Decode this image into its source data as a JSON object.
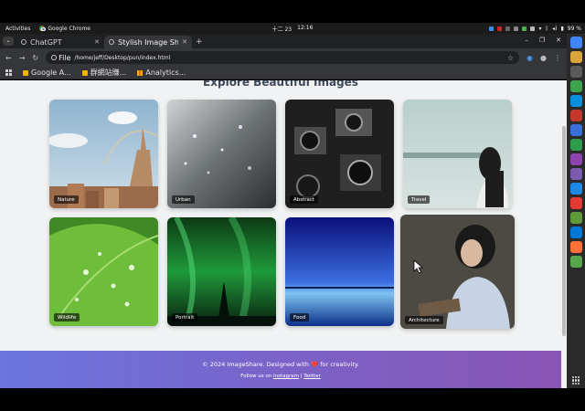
{
  "system": {
    "activities": "Activities",
    "app_name": "Google Chrome",
    "clock_date": "十二 23",
    "clock_time": "12:16",
    "battery": "99 %"
  },
  "tabs": [
    {
      "title": "ChatGPT",
      "active": false
    },
    {
      "title": "Stylish Image Sha",
      "active": true
    }
  ],
  "toolbar": {
    "chip_label": "File",
    "url": "/home/jeff/Desktop/pun/index.html"
  },
  "bookmarks": [
    {
      "label": "Google A...",
      "color": "#f4b400"
    },
    {
      "label": "群網站賺...",
      "color": "#f4b400"
    },
    {
      "label": "Analytics...",
      "color": "#f9ab00"
    }
  ],
  "page": {
    "section_title": "Explore Beautiful Images",
    "cards": [
      {
        "label": "Nature"
      },
      {
        "label": "Urban"
      },
      {
        "label": "Abstract"
      },
      {
        "label": "Travel"
      },
      {
        "label": "Wildlife"
      },
      {
        "label": "Portrait"
      },
      {
        "label": "Food"
      },
      {
        "label": "Architecture"
      }
    ]
  },
  "footer": {
    "line1_pre": "© 2024 ImageShare. Designed with",
    "heart": "❤️",
    "line1_post": "for creativity.",
    "line2_pre": "Follow us on",
    "instagram": "Instagram",
    "sep": "|",
    "twitter": "Twitter"
  },
  "dock_colors": [
    "#4285f4",
    "#d9a43b",
    "#5a5a5a",
    "#3fa34d",
    "#0a8fdb",
    "#c0392b",
    "#3a6fd8",
    "#2e9d4a",
    "#8e44ad",
    "#7b5bb0",
    "#1e88e5",
    "#e53935",
    "#5d9b3a",
    "#0078d4",
    "#ff7139",
    "#57a64a"
  ]
}
